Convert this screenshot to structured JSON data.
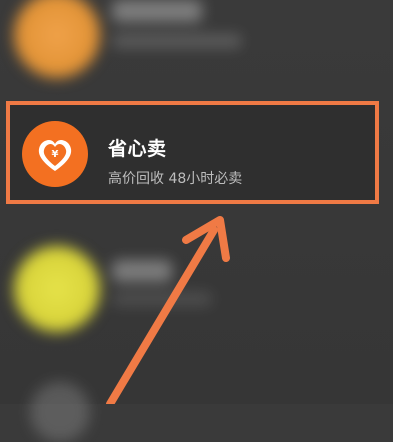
{
  "highlighted_app": {
    "name": "省心卖",
    "description": "高价回收 48小时必卖",
    "icon": "heart-yen-icon",
    "icon_color": "#f37021"
  },
  "annotation": {
    "highlight_color": "#f07a45",
    "arrow_color": "#f07a45"
  }
}
